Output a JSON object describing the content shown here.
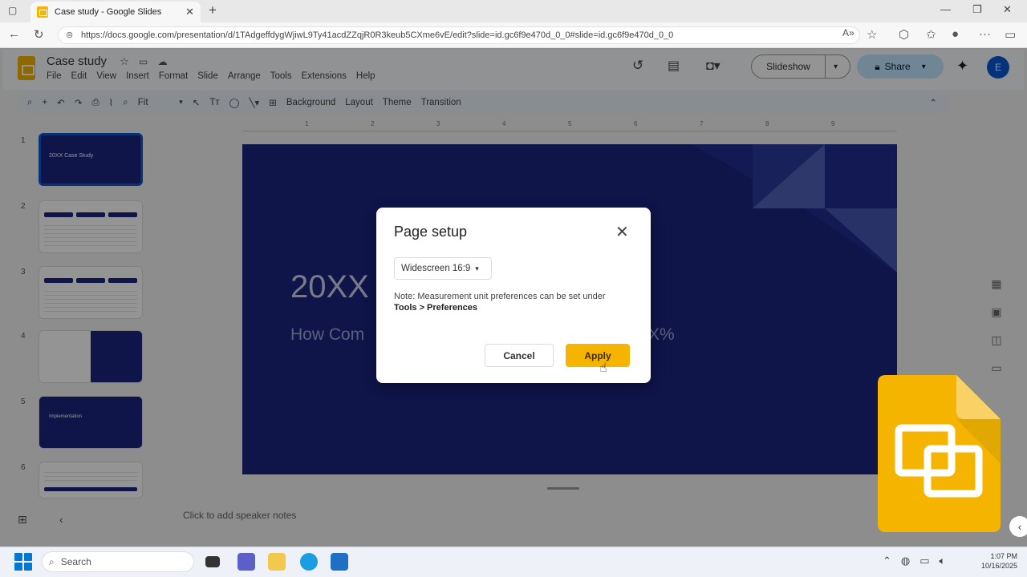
{
  "browser": {
    "tab_title": "Case study - Google Slides",
    "url": "https://docs.google.com/presentation/d/1TAdgeffdygWjiwL9Ty41acdZZqjR0R3keub5CXme6vE/edit?slide=id.gc6f9e470d_0_0#slide=id.gc6f9e470d_0_0",
    "new_tab": "+",
    "tab_close": "✕"
  },
  "app": {
    "doc_title": "Case study",
    "menu": [
      "File",
      "Edit",
      "View",
      "Insert",
      "Format",
      "Slide",
      "Arrange",
      "Tools",
      "Extensions",
      "Help"
    ],
    "slideshow_label": "Slideshow",
    "share_label": "Share",
    "avatar_initial": "E"
  },
  "toolbar": {
    "zoom": "Fit",
    "items": [
      "Background",
      "Layout",
      "Theme",
      "Transition"
    ]
  },
  "ruler_labels": [
    "1",
    "2",
    "3",
    "4",
    "5",
    "6",
    "7",
    "8",
    "9"
  ],
  "filmstrip": {
    "numbers": [
      "1",
      "2",
      "3",
      "4",
      "5",
      "6"
    ],
    "slide1_text": "20XX Case Study",
    "slide5_text": "Implementation"
  },
  "slide": {
    "title": "20XX",
    "subtitle_left": "How Com",
    "subtitle_right": "X%"
  },
  "notes_placeholder": "Click to add speaker notes",
  "dialog": {
    "title": "Page setup",
    "close": "✕",
    "size_option": "Widescreen 16:9",
    "note_text": "Note: Measurement unit preferences can be set under",
    "note_bold": "Tools > Preferences",
    "cancel_label": "Cancel",
    "apply_label": "Apply"
  },
  "taskbar": {
    "search_placeholder": "Search",
    "time": "1:07 PM",
    "date": "10/16/2025"
  },
  "colors": {
    "slide_bg": "#1a237e",
    "accent_yellow": "#f4b400",
    "share_bg": "#c2e7ff"
  }
}
